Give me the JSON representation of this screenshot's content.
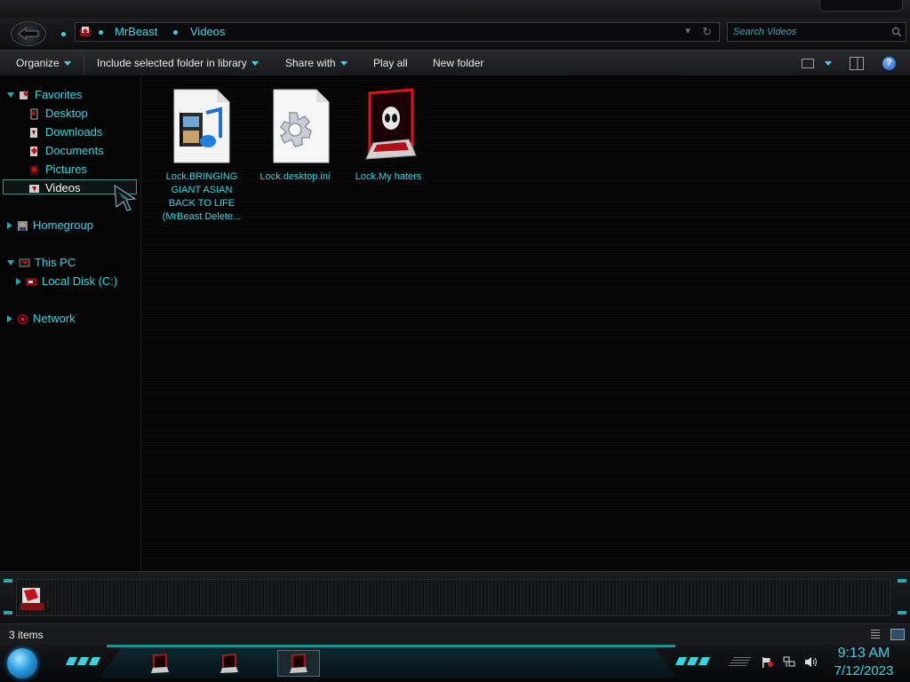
{
  "window": {
    "breadcrumbs": [
      "MrBeast",
      "Videos"
    ],
    "search_placeholder": "Search Videos"
  },
  "toolbar": {
    "organize": "Organize",
    "include_library": "Include selected folder in library",
    "share_with": "Share with",
    "play_all": "Play all",
    "new_folder": "New folder",
    "help": "?"
  },
  "sidebar": {
    "favorites": "Favorites",
    "desktop": "Desktop",
    "downloads": "Downloads",
    "documents": "Documents",
    "pictures": "Pictures",
    "videos": "Videos",
    "homegroup": "Homegroup",
    "this_pc": "This PC",
    "local_disk": "Local Disk (C:)",
    "network": "Network",
    "selected": "Videos"
  },
  "files": [
    {
      "line1": "Lock.BRINGING",
      "line2": "GIANT ASIAN",
      "line3": "BACK TO LIFE",
      "line4": "(MrBeast Delete...",
      "icon": "video-file-icon"
    },
    {
      "line1": "Lock.desktop.ini",
      "icon": "settings-file-icon"
    },
    {
      "line1": "Lock.My haters",
      "icon": "alien-folder-icon"
    }
  ],
  "status": {
    "item_count": "3 items"
  },
  "taskbar": {
    "time": "9:13 AM",
    "date": "7/12/2023"
  },
  "colors": {
    "accent": "#39d4e3",
    "background": "#000000",
    "alien_red": "#d0121c"
  }
}
